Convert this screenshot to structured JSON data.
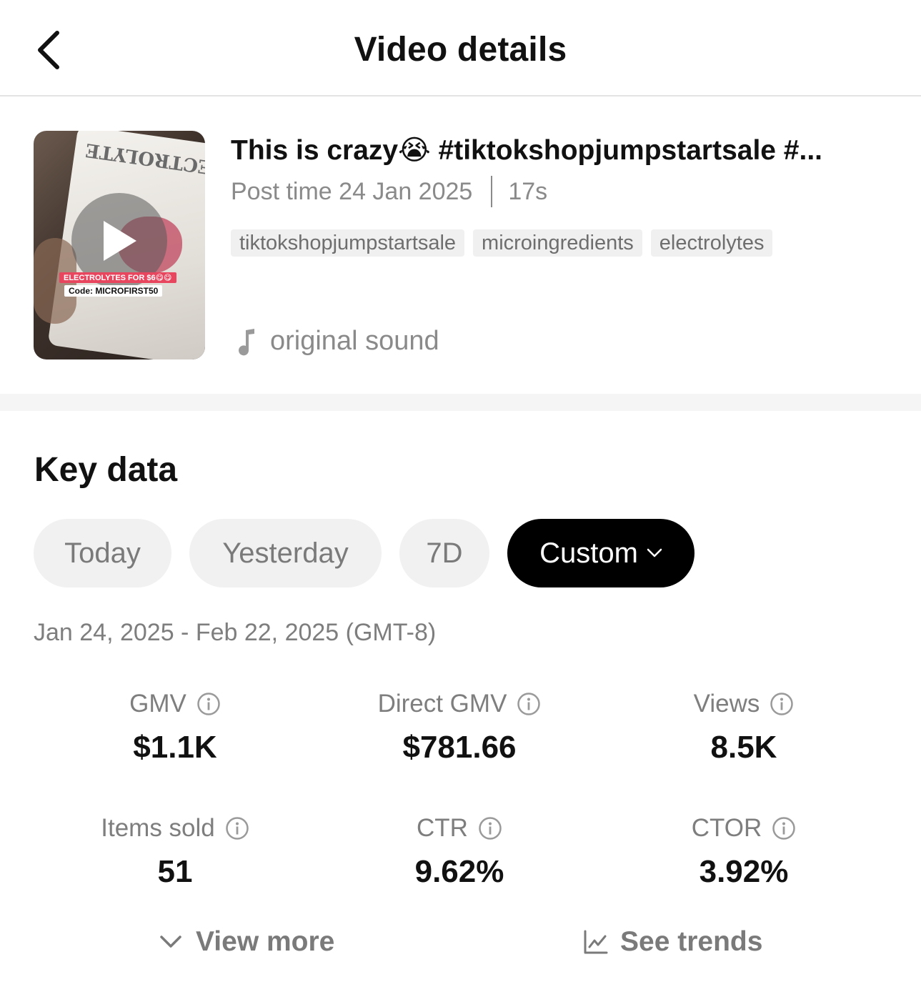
{
  "header": {
    "title": "Video details"
  },
  "video": {
    "title": "This is crazy😭 #tiktokshopjumpstartsale #...",
    "post_time": "Post time 24 Jan 2025",
    "duration": "17s",
    "tags": [
      "tiktokshopjumpstartsale",
      "microingredients",
      "electrolytes"
    ],
    "sound": "original sound",
    "thumbnail": {
      "sticker_top": "ELECTROLYTES FOR $6😋😋",
      "sticker_bottom": "Code: MICROFIRST50"
    }
  },
  "key_data": {
    "title": "Key data",
    "tabs": [
      "Today",
      "Yesterday",
      "7D",
      "Custom"
    ],
    "selected_tab": "Custom",
    "date_range": "Jan 24, 2025 - Feb 22, 2025 (GMT-8)",
    "metrics": [
      {
        "label": "GMV",
        "value": "$1.1K"
      },
      {
        "label": "Direct GMV",
        "value": "$781.66"
      },
      {
        "label": "Views",
        "value": "8.5K"
      },
      {
        "label": "Items sold",
        "value": "51"
      },
      {
        "label": "CTR",
        "value": "9.62%"
      },
      {
        "label": "CTOR",
        "value": "3.92%"
      }
    ],
    "view_more": "View more",
    "see_trends": "See trends"
  },
  "colors": {
    "selected_tab_bg": "#000000",
    "tab_bg": "#f1f1f1",
    "muted_text": "#7e7e7e"
  }
}
